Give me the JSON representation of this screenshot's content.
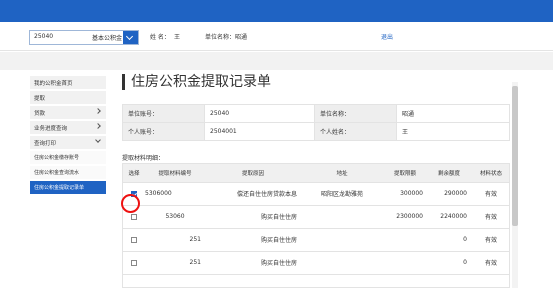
{
  "header": {
    "account_number": "25040",
    "account_type": "基本公积金",
    "name_label": "姓 名：",
    "name_value": "王",
    "unit_label": "单位名称：",
    "unit_value": "昭通",
    "logout": "退出"
  },
  "sidebar": {
    "items": [
      {
        "label": "我的公积金首页",
        "chevron": false
      },
      {
        "label": "提取",
        "chevron": false
      },
      {
        "label": "贷款",
        "chevron": true
      },
      {
        "label": "业务进度查询",
        "chevron": true
      },
      {
        "label": "查询打印",
        "chevron": true
      }
    ],
    "subitems": [
      {
        "label": "住房公积金缴存账号",
        "active": false
      },
      {
        "label": "住房公积金查询流水",
        "active": false
      },
      {
        "label": "住房公积金提取记录单",
        "active": true
      }
    ]
  },
  "page_title": "住房公积金提取记录单",
  "info": {
    "acct_label": "单位账号：",
    "acct_value": "25040",
    "unit_label": "单位名称：",
    "unit_value": "昭通",
    "person_acct_label": "个人账号：",
    "person_acct_value": "2504001",
    "person_name_label": "个人姓名：",
    "person_name_value": "王"
  },
  "section_label": "提取材料明细：",
  "table": {
    "headers": [
      "选择",
      "提取材料编号",
      "提取原因",
      "地址",
      "提取限额",
      "剩余额度",
      "材料状态"
    ],
    "rows": [
      {
        "checked": true,
        "id": "5306000",
        "reason": "偿还自住住房贷款本息",
        "address": "昭阳区龙勘雅苑",
        "limit": "300000",
        "remain": "290000",
        "status": "有效"
      },
      {
        "checked": false,
        "id": "53060",
        "reason": "购买自住住房",
        "address": "",
        "limit": "2300000",
        "remain": "2240000",
        "status": "有效"
      },
      {
        "checked": false,
        "id": "251",
        "reason": "购买自住住房",
        "address": "",
        "limit": "",
        "remain": "0",
        "status": "有效"
      },
      {
        "checked": false,
        "id": "251",
        "reason": "购买自住住房",
        "address": "",
        "limit": "",
        "remain": "0",
        "status": "有效"
      }
    ]
  },
  "colors": {
    "brand": "#1f63c3",
    "highlight_circle": "#e11111"
  }
}
